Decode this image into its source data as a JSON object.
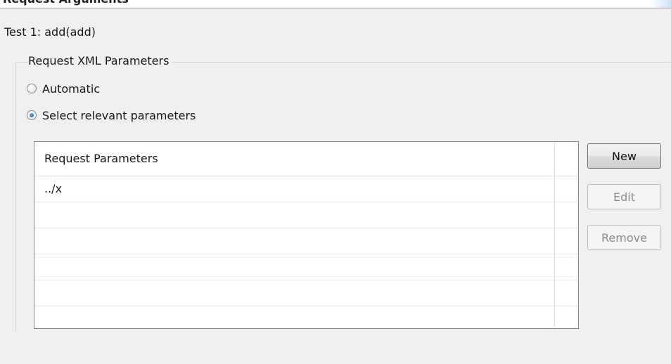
{
  "header": {
    "partial_title": "Request Arguments"
  },
  "test_title": "Test 1: add(add)",
  "group": {
    "legend": "Request XML Parameters",
    "radio_automatic": {
      "label": "Automatic",
      "checked": false
    },
    "radio_select": {
      "label": "Select relevant parameters",
      "checked": true
    }
  },
  "table": {
    "header": "Request Parameters",
    "rows": [
      "../x",
      "",
      "",
      "",
      "",
      ""
    ]
  },
  "buttons": {
    "new": {
      "label": "New",
      "enabled": true
    },
    "edit": {
      "label": "Edit",
      "enabled": false
    },
    "remove": {
      "label": "Remove",
      "enabled": false
    }
  }
}
